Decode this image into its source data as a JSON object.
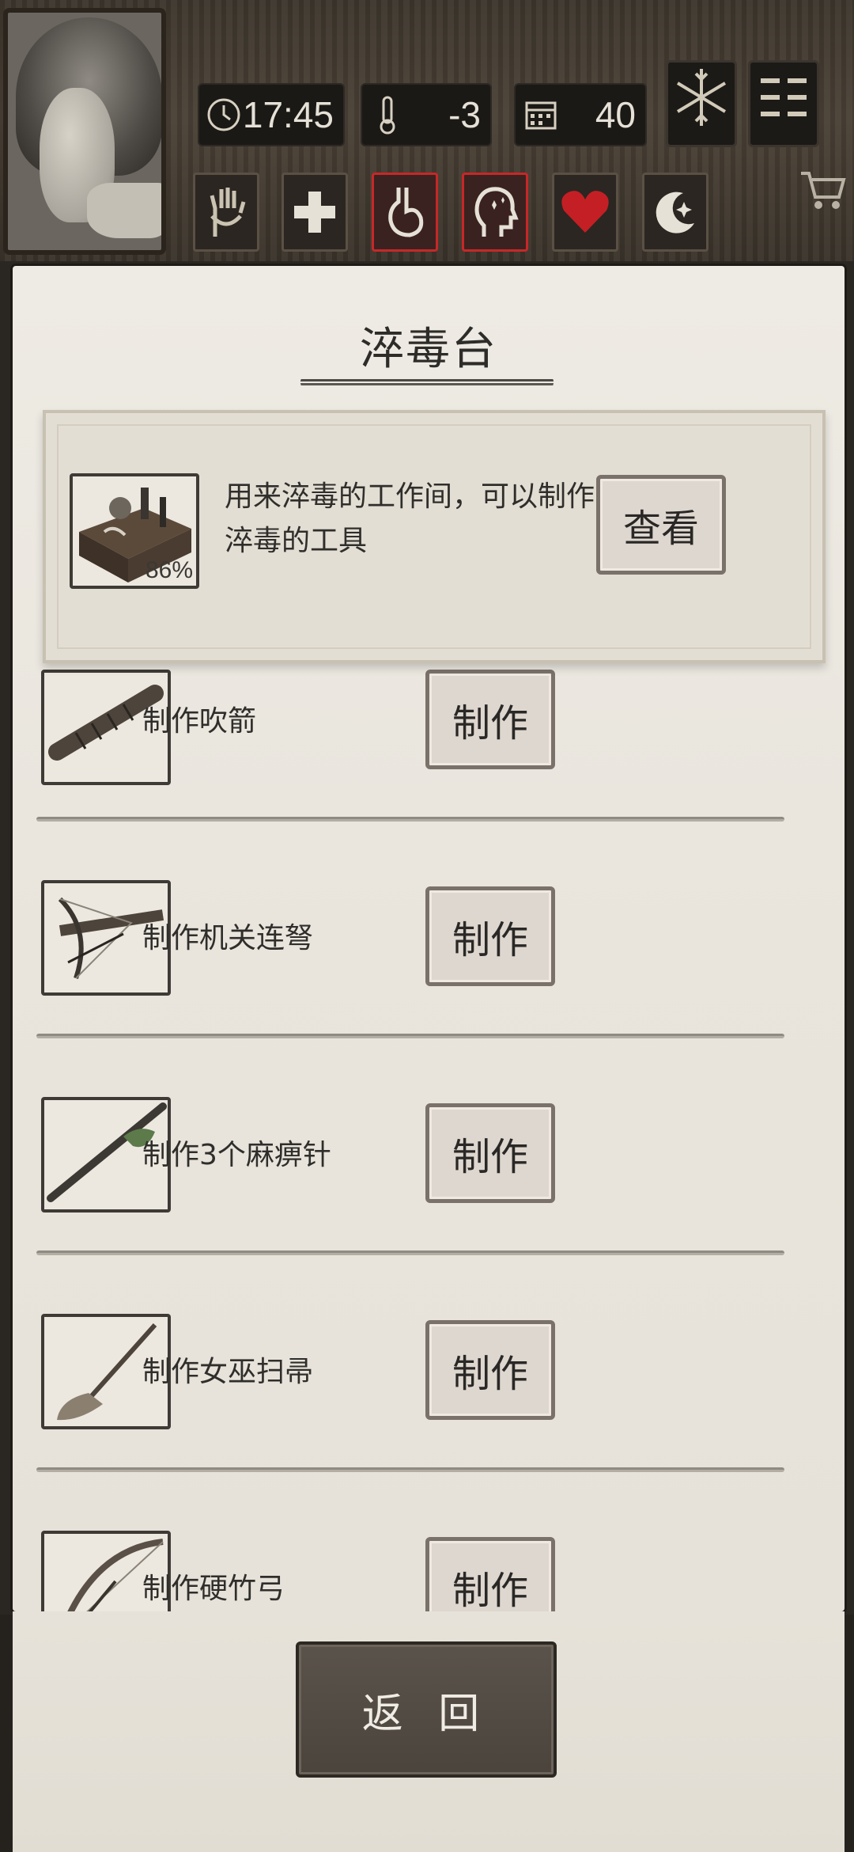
{
  "hud": {
    "time": "17:45",
    "temperature": "-3",
    "day": "40",
    "clock_icon": "clock-icon",
    "thermometer_icon": "thermometer-icon",
    "calendar_icon": "calendar-icon",
    "snowflake_icon": "snowflake-icon",
    "menu_icon": "menu-icon",
    "cart_icon": "shopping-cart-icon",
    "status_icons": [
      {
        "name": "hand-bandage-icon",
        "highlighted": false
      },
      {
        "name": "health-cross-icon",
        "highlighted": false
      },
      {
        "name": "stomach-icon",
        "highlighted": true
      },
      {
        "name": "mind-icon",
        "highlighted": true
      },
      {
        "name": "heart-icon",
        "highlighted": false
      },
      {
        "name": "moon-star-icon",
        "highlighted": false
      }
    ],
    "highlight_color": "#c62828"
  },
  "panel": {
    "title": "淬毒台",
    "featured": {
      "description": "用来淬毒的工作间，可以制作淬毒的工具",
      "progress": "86%",
      "button": "查看",
      "icon": "workbench-icon"
    },
    "recipes": [
      {
        "label": "制作吹箭",
        "button": "制作",
        "icon": "blowgun-icon"
      },
      {
        "label": "制作机关连弩",
        "button": "制作",
        "icon": "crossbow-icon"
      },
      {
        "label": "制作3个麻痹针",
        "button": "制作",
        "icon": "needle-icon"
      },
      {
        "label": "制作女巫扫帚",
        "button": "制作",
        "icon": "broom-icon"
      },
      {
        "label": "制作硬竹弓",
        "button": "制作",
        "icon": "bow-icon"
      }
    ]
  },
  "footer": {
    "back_button": "返 回"
  }
}
